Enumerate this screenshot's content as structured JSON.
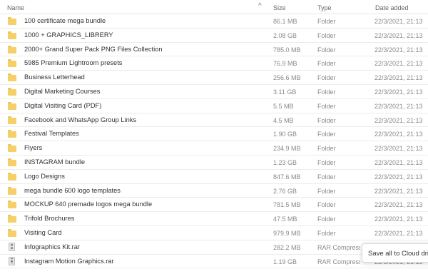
{
  "header": {
    "name_label": "Name",
    "size_label": "Size",
    "type_label": "Type",
    "date_label": "Date added",
    "sort_indicator": "^"
  },
  "files": [
    {
      "name": "100 certificate mega bundle",
      "size": "86.1 MB",
      "type": "Folder",
      "date": "22/3/2021, 21:13",
      "icon": "folder-icon"
    },
    {
      "name": "1000 + GRAPHICS_LIBRERY",
      "size": "2.08 GB",
      "type": "Folder",
      "date": "22/3/2021, 21:13",
      "icon": "folder-icon"
    },
    {
      "name": "2000+ Grand Super Pack PNG Files Collection",
      "size": "785.0 MB",
      "type": "Folder",
      "date": "22/3/2021, 21:13",
      "icon": "folder-icon"
    },
    {
      "name": "5985 Premium Lightroom presets",
      "size": "76.9 MB",
      "type": "Folder",
      "date": "22/3/2021, 21:13",
      "icon": "folder-icon"
    },
    {
      "name": "Business Letterhead",
      "size": "256.6 MB",
      "type": "Folder",
      "date": "22/3/2021, 21:13",
      "icon": "folder-icon"
    },
    {
      "name": "Digital Marketing Courses",
      "size": "3.11 GB",
      "type": "Folder",
      "date": "22/3/2021, 21:13",
      "icon": "folder-icon"
    },
    {
      "name": "Digital Visiting Card (PDF)",
      "size": "5.5 MB",
      "type": "Folder",
      "date": "22/3/2021, 21:13",
      "icon": "folder-icon"
    },
    {
      "name": "Facebook and WhatsApp Group Links",
      "size": "4.5 MB",
      "type": "Folder",
      "date": "22/3/2021, 21:13",
      "icon": "folder-icon"
    },
    {
      "name": "Festival Templates",
      "size": "1.90 GB",
      "type": "Folder",
      "date": "22/3/2021, 21:13",
      "icon": "folder-icon"
    },
    {
      "name": "Flyers",
      "size": "234.9 MB",
      "type": "Folder",
      "date": "22/3/2021, 21:13",
      "icon": "folder-icon"
    },
    {
      "name": "INSTAGRAM bundle",
      "size": "1.23 GB",
      "type": "Folder",
      "date": "22/3/2021, 21:13",
      "icon": "folder-icon"
    },
    {
      "name": "Logo Designs",
      "size": "847.6 MB",
      "type": "Folder",
      "date": "22/3/2021, 21:13",
      "icon": "folder-icon"
    },
    {
      "name": "mega bundle 600 logo templates",
      "size": "2.76 GB",
      "type": "Folder",
      "date": "22/3/2021, 21:13",
      "icon": "folder-icon"
    },
    {
      "name": "MOCKUP 640 premade logos mega bundle",
      "size": "781.5 MB",
      "type": "Folder",
      "date": "22/3/2021, 21:13",
      "icon": "folder-icon"
    },
    {
      "name": "Trifold Brochures",
      "size": "47.5 MB",
      "type": "Folder",
      "date": "22/3/2021, 21:13",
      "icon": "folder-icon"
    },
    {
      "name": "Visiting Card",
      "size": "979.9 MB",
      "type": "Folder",
      "date": "22/3/2021, 21:13",
      "icon": "folder-icon"
    },
    {
      "name": "Infographics Kit.rar",
      "size": "282.2 MB",
      "type": "RAR Compress",
      "date": "22/3/2021, 21:13",
      "icon": "archive-icon"
    },
    {
      "name": "Instagram Motion Graphics.rar",
      "size": "1.19 GB",
      "type": "RAR Compress",
      "date": "22/3/2021, 21:13",
      "icon": "archive-icon"
    }
  ],
  "save_button_label": "Save all to Cloud drive",
  "colors": {
    "folder": "#f6cf68",
    "text": "#333333",
    "muted": "#8a8a8a",
    "divider": "#ececec"
  }
}
